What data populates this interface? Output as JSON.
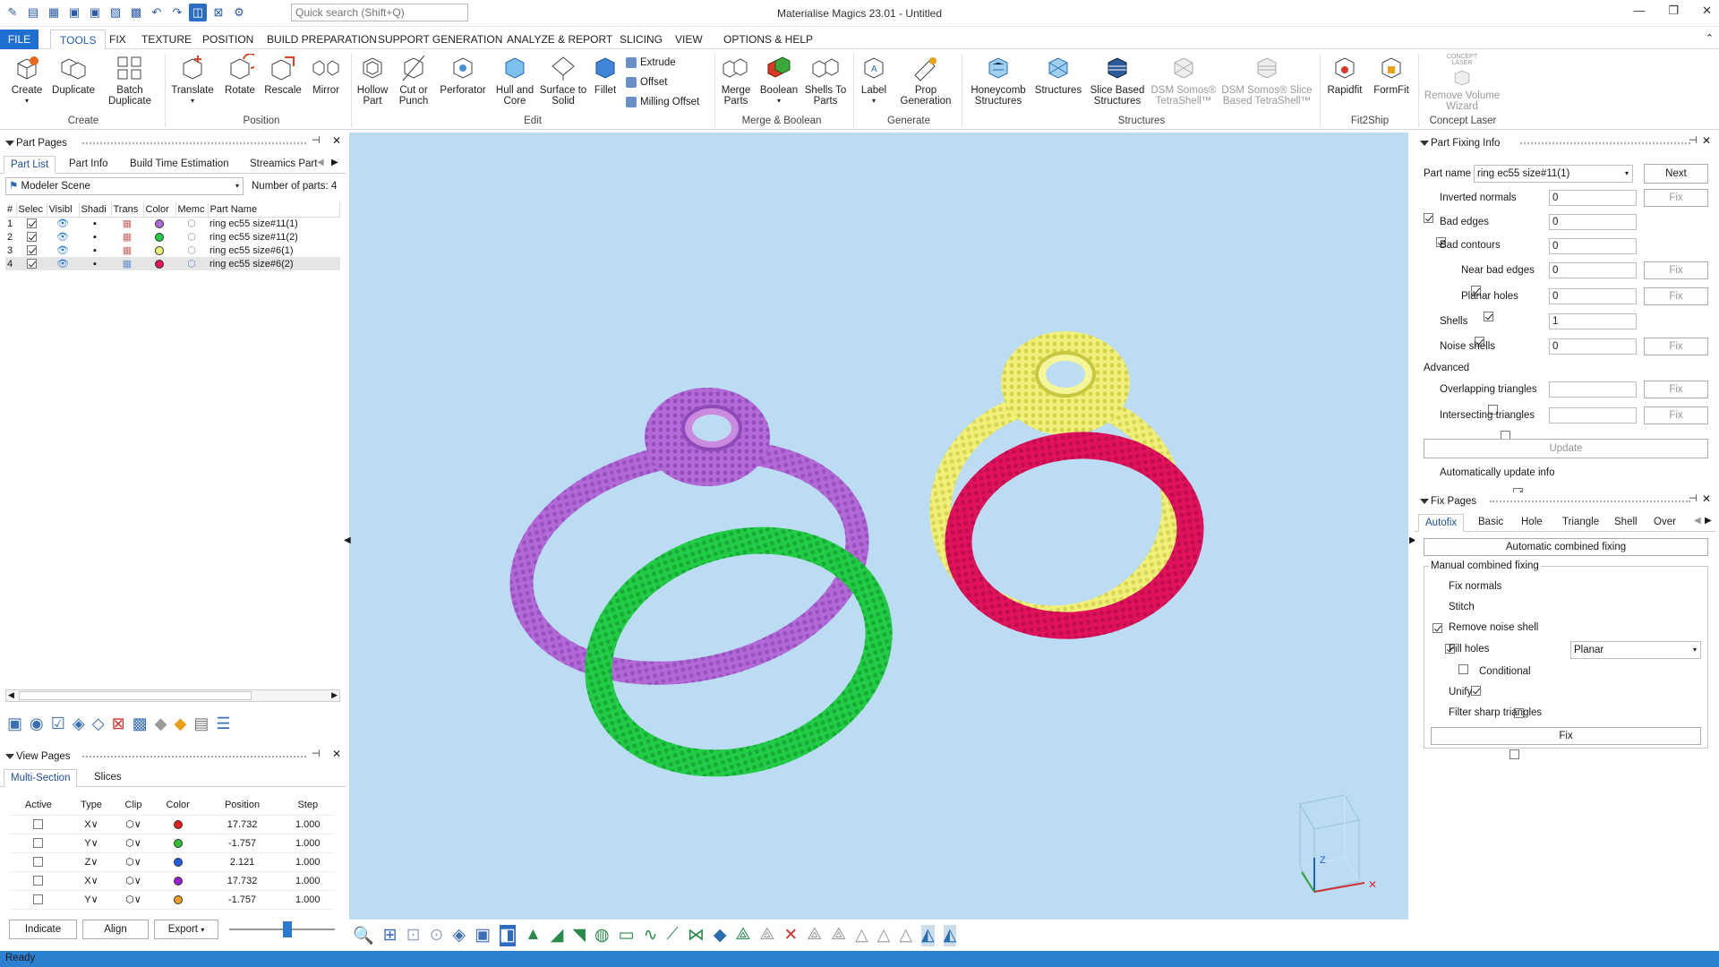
{
  "app": {
    "title": "Materialise Magics 23.01 - Untitled",
    "search_placeholder": "Quick search (Shift+Q)"
  },
  "menu": {
    "tabs": [
      "FILE",
      "TOOLS",
      "FIX",
      "TEXTURE",
      "POSITION",
      "BUILD PREPARATION",
      "SUPPORT GENERATION",
      "ANALYZE & REPORT",
      "SLICING",
      "VIEW",
      "OPTIONS & HELP"
    ],
    "selected": "TOOLS"
  },
  "ribbon": {
    "create": {
      "group": "Create",
      "buttons": [
        "Create",
        "Duplicate",
        "Batch\nDuplicate"
      ]
    },
    "position": {
      "group": "Position",
      "buttons": [
        "Translate",
        "Rotate",
        "Rescale",
        "Mirror"
      ]
    },
    "edit": {
      "group": "Edit",
      "buttons": [
        "Hollow\nPart",
        "Cut or\nPunch",
        "Perforator",
        "Hull and\nCore",
        "Surface to\nSolid",
        "Fillet"
      ],
      "small": [
        "Extrude",
        "Offset",
        "Milling Offset"
      ]
    },
    "merge": {
      "group": "Merge & Boolean",
      "buttons": [
        "Merge\nParts",
        "Boolean",
        "Shells To\nParts"
      ]
    },
    "generate": {
      "group": "Generate",
      "buttons": [
        "Label",
        "Prop\nGeneration"
      ]
    },
    "structures": {
      "group": "Structures",
      "buttons": [
        "Honeycomb\nStructures",
        "Structures",
        "Slice Based\nStructures",
        "DSM Somos®\nTetraShell™",
        "DSM Somos® Slice\nBased TetraShell™"
      ]
    },
    "fit2ship": {
      "group": "Fit2Ship",
      "buttons": [
        "Rapidfit",
        "FormFit"
      ]
    },
    "concept": {
      "group": "Concept Laser",
      "buttons": [
        "Remove Volume\nWizard"
      ],
      "logo": "CONCEPT\nLASER"
    }
  },
  "part_pages": {
    "title": "Part Pages",
    "tabs": [
      "Part List",
      "Part Info",
      "Build Time Estimation",
      "Streamics Part"
    ],
    "scene": "Modeler Scene",
    "count_label": "Number of parts:",
    "count": "4",
    "columns": [
      "#",
      "Selec",
      "Visibl",
      "Shadi",
      "Trans",
      "Color",
      "Memc",
      "Part Name"
    ],
    "rows": [
      {
        "num": "1",
        "color": "#b36ad6",
        "name": "ring ec55 size#11(1)"
      },
      {
        "num": "2",
        "color": "#22cc44",
        "name": "ring ec55 size#11(2)"
      },
      {
        "num": "3",
        "color": "#f0f07a",
        "name": "ring ec55 size#6(1)"
      },
      {
        "num": "4",
        "color": "#e0125c",
        "name": "ring ec55 size#6(2)"
      }
    ]
  },
  "view_pages": {
    "title": "View Pages",
    "tabs": [
      "Multi-Section",
      "Slices"
    ],
    "columns": [
      "Active",
      "Type",
      "Clip",
      "Color",
      "Position",
      "Step"
    ],
    "rows": [
      {
        "type": "X",
        "color": "#e02020",
        "position": "17.732",
        "step": "1.000"
      },
      {
        "type": "Y",
        "color": "#30c030",
        "position": "-1.757",
        "step": "1.000"
      },
      {
        "type": "Z",
        "color": "#2060e0",
        "position": "2.121",
        "step": "1.000"
      },
      {
        "type": "X",
        "color": "#9a20d0",
        "position": "17.732",
        "step": "1.000"
      },
      {
        "type": "Y",
        "color": "#f0a020",
        "position": "-1.757",
        "step": "1.000"
      }
    ],
    "buttons": [
      "Indicate",
      "Align",
      "Export"
    ]
  },
  "part_fixing": {
    "title": "Part Fixing Info",
    "part_name_label": "Part name",
    "part_name": "ring ec55 size#11(1)",
    "next": "Next",
    "rows": [
      {
        "label": "Inverted normals",
        "value": "0",
        "checked": true,
        "fix": true
      },
      {
        "label": "Bad edges",
        "value": "0",
        "checked": true,
        "fix": false
      },
      {
        "label": "Bad contours",
        "value": "0",
        "checked": null,
        "fix": false
      },
      {
        "label": "Near bad edges",
        "value": "0",
        "checked": true,
        "fix": true
      },
      {
        "label": "Planar holes",
        "value": "0",
        "checked": true,
        "fix": true
      },
      {
        "label": "Shells",
        "value": "1",
        "checked": true,
        "fix": false
      },
      {
        "label": "Noise shells",
        "value": "0",
        "checked": null,
        "fix": true
      }
    ],
    "advanced": "Advanced",
    "adv_rows": [
      "Overlapping triangles",
      "Intersecting triangles"
    ],
    "fix_label": "Fix",
    "update": "Update",
    "auto_update": "Automatically update info"
  },
  "fix_pages": {
    "title": "Fix Pages",
    "tabs": [
      "Autofix",
      "Basic",
      "Hole",
      "Triangle",
      "Shell",
      "Over"
    ],
    "auto_btn": "Automatic combined fixing",
    "manual": "Manual combined fixing",
    "options": [
      {
        "label": "Fix normals",
        "checked": true
      },
      {
        "label": "Stitch",
        "checked": true
      },
      {
        "label": "Remove noise shell",
        "checked": false
      },
      {
        "label": "Fill holes",
        "checked": true
      },
      {
        "label": "Conditional",
        "checked": false
      },
      {
        "label": "Unify",
        "checked": false
      },
      {
        "label": "Filter sharp triangles",
        "checked": false
      }
    ],
    "fill_mode": "Planar",
    "fix": "Fix"
  },
  "status": "Ready"
}
